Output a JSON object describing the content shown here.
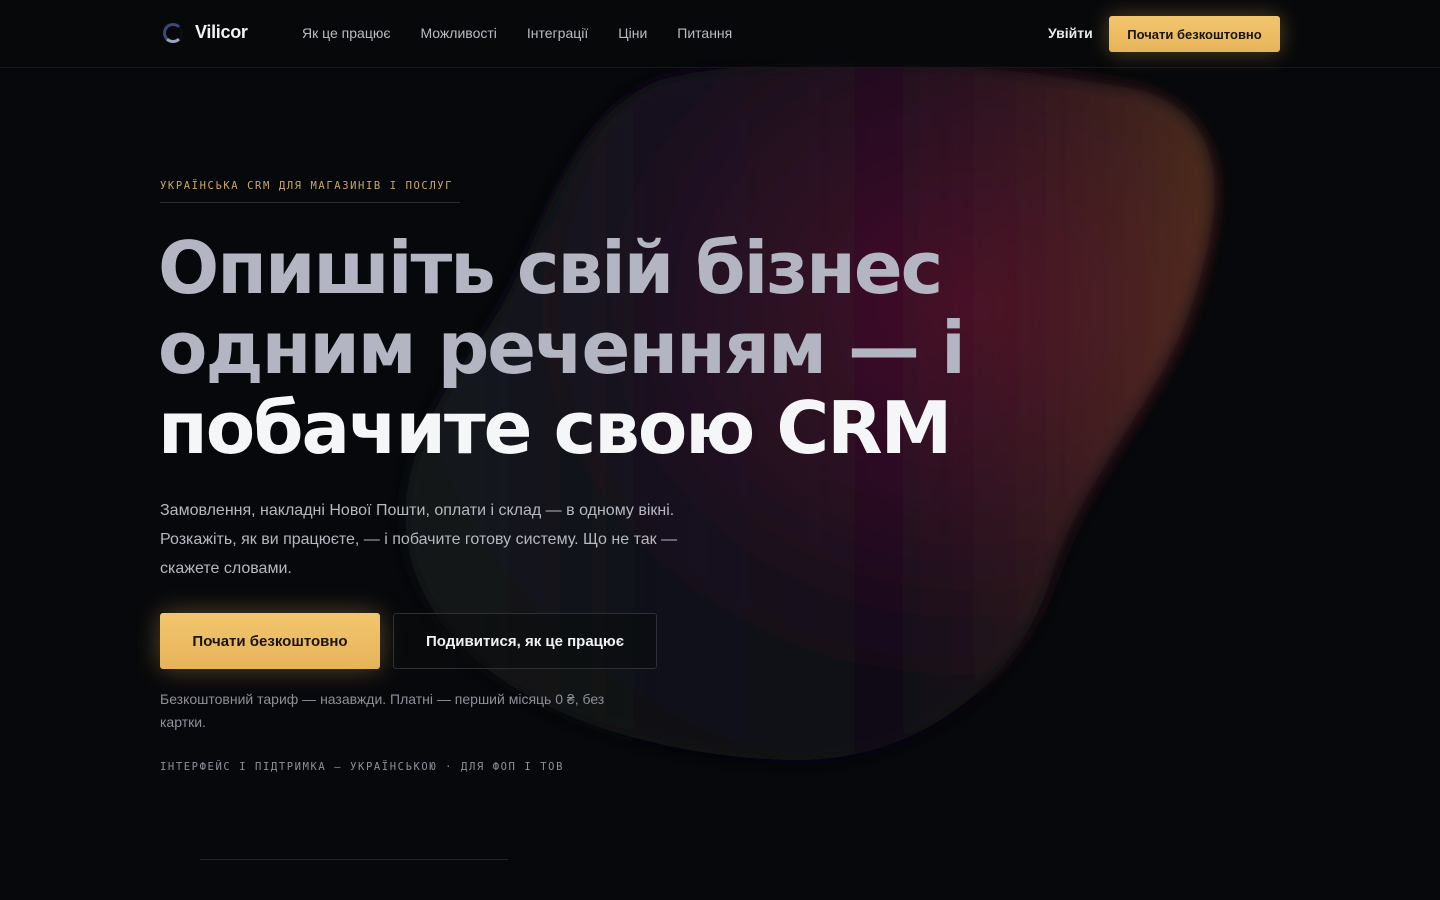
{
  "brand": {
    "name": "Vilicor",
    "logo_icon": "ring-logo-icon"
  },
  "nav": {
    "items": [
      {
        "label": "Як це працює"
      },
      {
        "label": "Можливості"
      },
      {
        "label": "Інтеграції"
      },
      {
        "label": "Ціни"
      },
      {
        "label": "Питання"
      }
    ],
    "login_label": "Увійти",
    "cta_label": "Почати безкоштовно"
  },
  "hero": {
    "eyebrow": "УКРАЇНСЬКА CRM ДЛЯ МАГАЗИНІВ І ПОСЛУГ",
    "headline_line1": "Опишіть свій бізнес",
    "headline_line2": "одним реченням — і",
    "headline_line3": "побачите свою CRM",
    "lead": "Замовлення, накладні Нової Пошти, оплати і склад — в одному вікні. Розкажіть, як ви працюєте, — і побачите готову систему. Що не так — скажете словами.",
    "primary_cta": "Почати безкоштовно",
    "secondary_cta": "Подивитися, як це працює",
    "note": "Безкоштовний тариф — назавжди. Платні — перший місяць 0 ₴, без картки.",
    "tagline": "ІНТЕРФЕЙС І ПІДТРИМКА — УКРАЇНСЬКОЮ · ДЛЯ ФОП І ТОВ"
  },
  "colors": {
    "background": "#07080b",
    "accent": "#f0c06a",
    "headline_muted": "#b3b6c2",
    "headline_bright": "#f5f6f8"
  }
}
